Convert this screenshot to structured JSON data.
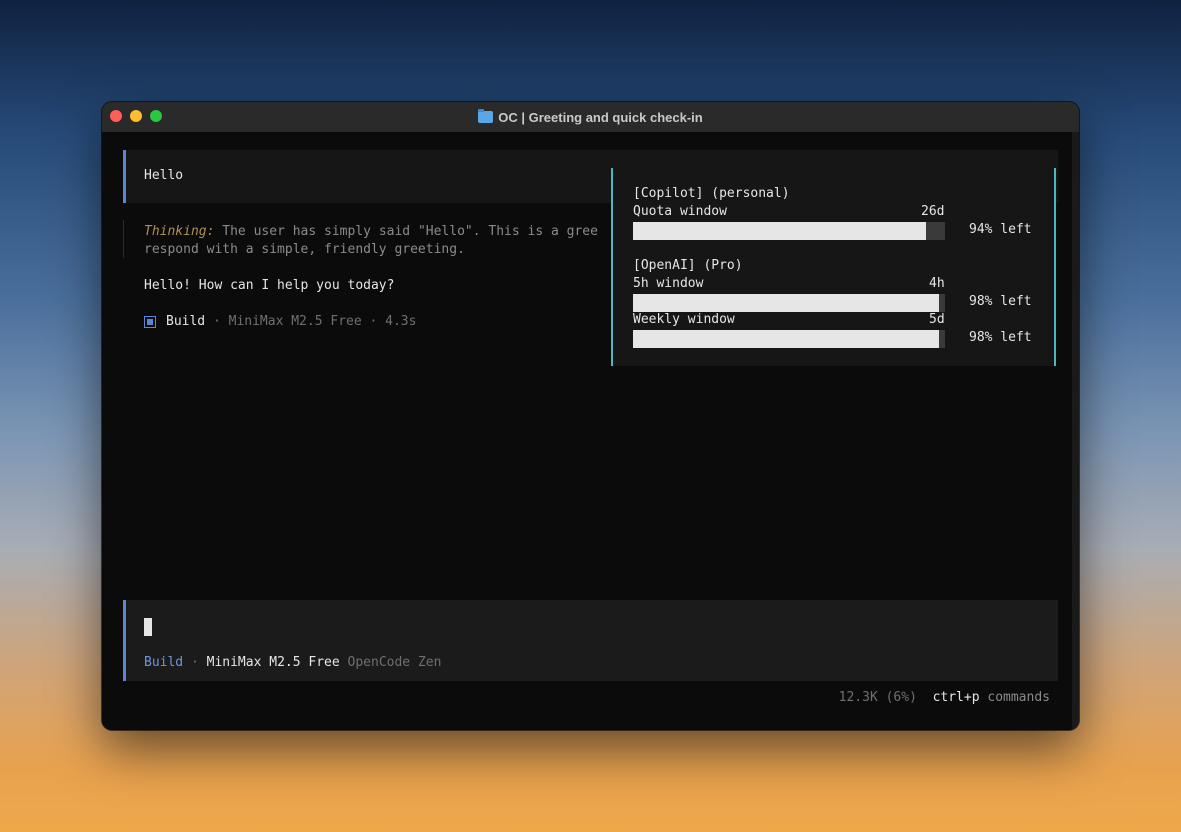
{
  "window": {
    "title": "OC | Greeting and quick check-in"
  },
  "chat": {
    "user_message": "Hello",
    "thinking_label": "Thinking:",
    "thinking_line1": " The user has simply said \"Hello\". This is a gree",
    "thinking_line2": "respond with a simple, friendly greeting.",
    "reply": "Hello! How can I help you today?",
    "build": {
      "mode": "Build",
      "model_meta": " · MiniMax M2.5 Free · 4.3s"
    }
  },
  "quota": {
    "sections": [
      {
        "header": "[Copilot] (personal)",
        "windows": [
          {
            "label": "Quota window",
            "remaining": "26d",
            "fraction_left": 0.94,
            "left_text": "94% left"
          }
        ]
      },
      {
        "header": "[OpenAI] (Pro)",
        "windows": [
          {
            "label": "5h window",
            "remaining": "4h",
            "fraction_left": 0.98,
            "left_text": "98% left"
          },
          {
            "label": "Weekly window",
            "remaining": "5d",
            "fraction_left": 0.98,
            "left_text": "98% left"
          }
        ]
      }
    ]
  },
  "input": {
    "mode": "Build",
    "separator": " · ",
    "model": "MiniMax M2.5 Free",
    "provider": " OpenCode Zen"
  },
  "footer": {
    "tokens": "12.3K (6%)",
    "shortcut": "ctrl+p",
    "shortcut_label": " commands"
  },
  "colors": {
    "accent_blue": "#5b86d6",
    "quota_border": "#4fb5c2",
    "thinking_label": "#b08e54"
  }
}
